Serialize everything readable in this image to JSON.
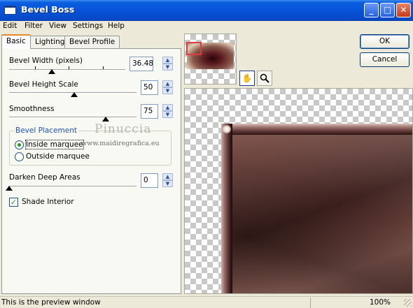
{
  "window": {
    "title": "Bevel Boss"
  },
  "menu": [
    "Edit",
    "Filter",
    "View",
    "Settings",
    "Help"
  ],
  "tabs": [
    "Basic",
    "Lighting",
    "Bevel Profile"
  ],
  "controls": {
    "bevel_width": {
      "label": "Bevel Width (pixels)",
      "value": "36.48"
    },
    "bevel_height": {
      "label": "Bevel Height Scale",
      "value": "50"
    },
    "smoothness": {
      "label": "Smoothness",
      "value": "75"
    },
    "placement": {
      "title": "Bevel Placement",
      "options": [
        "Inside marquee",
        "Outside marquee"
      ],
      "selected": "Inside marquee"
    },
    "darken": {
      "label": "Darken Deep Areas",
      "value": "0"
    },
    "shade_interior": {
      "label": "Shade Interior",
      "checked": true
    }
  },
  "watermark": {
    "name": "Pinuccia",
    "url": "www.maidiregrafica.eu"
  },
  "buttons": {
    "ok": "OK",
    "cancel": "Cancel"
  },
  "status": {
    "text": "This is the preview window",
    "zoom": "100%"
  },
  "icons": {
    "pan": "hand-icon",
    "zoom": "magnifier-icon"
  }
}
